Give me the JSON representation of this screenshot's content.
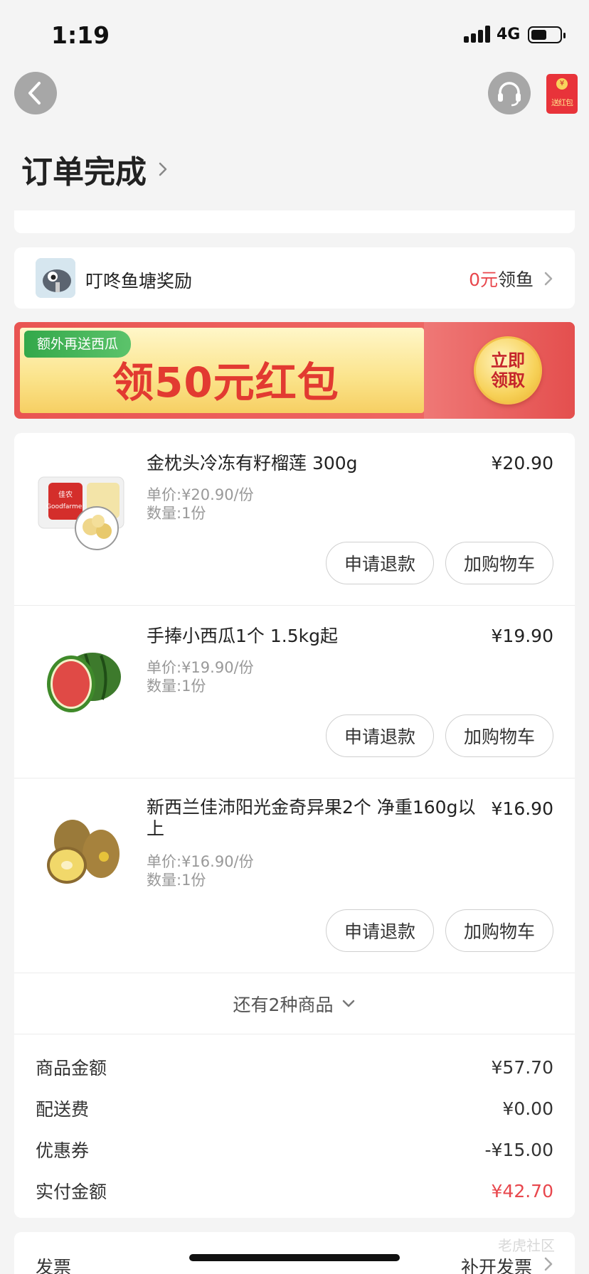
{
  "status_bar": {
    "time": "1:19",
    "network": "4G",
    "battery_level": 0.55
  },
  "nav": {
    "red_packet_label": "送红包",
    "coin_symbol": "¥"
  },
  "page": {
    "title": "订单完成"
  },
  "reward": {
    "title": "叮咚鱼塘奖励",
    "amount": "0元",
    "action": "领鱼"
  },
  "promo_banner": {
    "tag": "额外再送西瓜",
    "headline": "领50元红包",
    "claim_button": "立即领取"
  },
  "products": [
    {
      "name": "金枕头冷冻有籽榴莲 300g",
      "price": "¥20.90",
      "unit_price": "单价:¥20.90/份",
      "quantity": "数量:1份",
      "thumb_text": "佳农 Goodfarmer",
      "refund_label": "申请退款",
      "cart_label": "加购物车"
    },
    {
      "name": "手捧小西瓜1个 1.5kg起",
      "price": "¥19.90",
      "unit_price": "单价:¥19.90/份",
      "quantity": "数量:1份",
      "refund_label": "申请退款",
      "cart_label": "加购物车"
    },
    {
      "name": "新西兰佳沛阳光金奇异果2个 净重160g以上",
      "price": "¥16.90",
      "unit_price": "单价:¥16.90/份",
      "quantity": "数量:1份",
      "refund_label": "申请退款",
      "cart_label": "加购物车"
    }
  ],
  "more_items": "还有2种商品",
  "summary": [
    {
      "label": "商品金额",
      "value": "¥57.70"
    },
    {
      "label": "配送费",
      "value": "¥0.00"
    },
    {
      "label": "优惠券",
      "value": "-¥15.00"
    },
    {
      "label": "实付金额",
      "value": "¥42.70"
    }
  ],
  "invoice": {
    "label": "发票",
    "action": "补开发票"
  },
  "watermark": "老虎社区",
  "colors": {
    "accent_red": "#e8474d",
    "banner_red": "#e95452",
    "tag_green": "#33a84a"
  }
}
